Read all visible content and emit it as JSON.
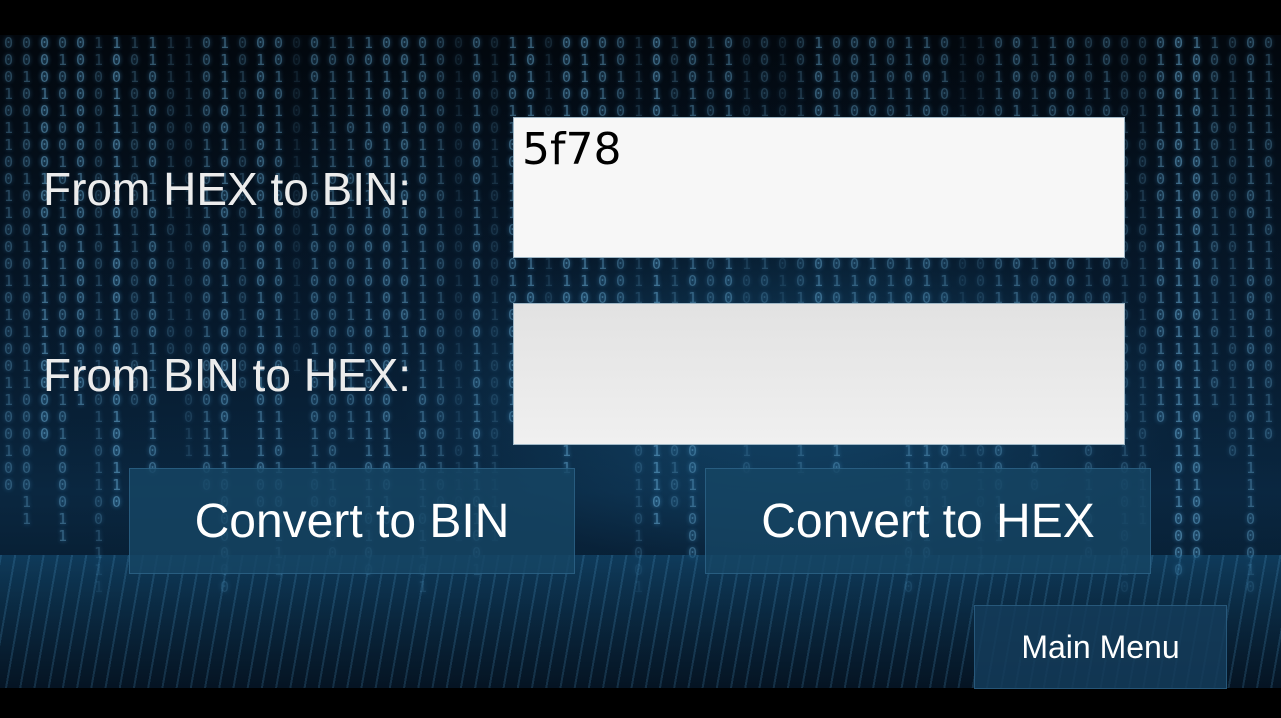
{
  "labels": {
    "hex_to_bin": "From HEX to BIN:",
    "bin_to_hex": "From BIN to HEX:"
  },
  "inputs": {
    "hex_value": "5f78",
    "bin_value": ""
  },
  "buttons": {
    "convert_to_bin": "Convert to BIN",
    "convert_to_hex": "Convert to HEX",
    "main_menu": "Main Menu"
  }
}
